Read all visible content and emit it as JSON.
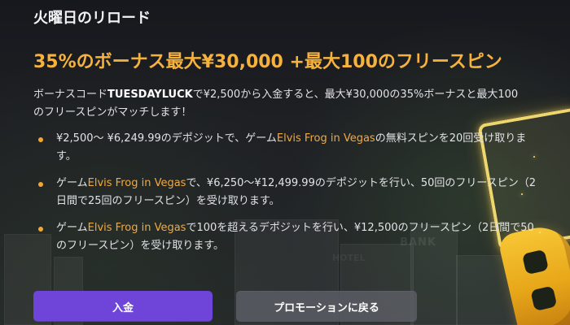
{
  "page": {
    "title": "火曜日のリロード",
    "headline": "35%のボーナス最大¥30,000 +最大100のフリースピン"
  },
  "intro": {
    "prefix": "ボーナスコード",
    "code": "TUESDAYLUCK",
    "suffix": "で¥2,500から入金すると、最大¥30,000の35%ボーナスと最大100のフリースピンがマッチします！"
  },
  "bullets": [
    {
      "text_before": "¥2,500～ ¥6,249.99のデポジットで、ゲーム",
      "game": "Elvis Frog in Vegas",
      "text_after": "の無料スピンを20回受け取ります。"
    },
    {
      "text_before": "ゲーム",
      "game": "Elvis Frog in Vegas",
      "text_after": "で、¥6,250～¥12,499.99のデポジットを行い、50回のフリースピン（2日間で25回のフリースピン）を受け取ります。"
    },
    {
      "text_before": "ゲーム",
      "game": "Elvis Frog in Vegas",
      "text_after": "で100を超えるデポジットを行い、¥12,500のフリースピン（2日間で50のフリースピン）を受け取ります。"
    }
  ],
  "buttons": {
    "deposit": "入金",
    "back_to_promotions": "プロモーションに戻る"
  },
  "background": {
    "bank_sign": "BANK",
    "hotel_sign": "HOTEL"
  },
  "colors": {
    "accent": "#f6b23d",
    "primary_button": "#6e45d8",
    "secondary_button": "#5d5f66",
    "background": "#1e2024"
  },
  "icons": {
    "bullet": "bullet-dot-icon",
    "decoration": "casino-letter-b-icon"
  }
}
